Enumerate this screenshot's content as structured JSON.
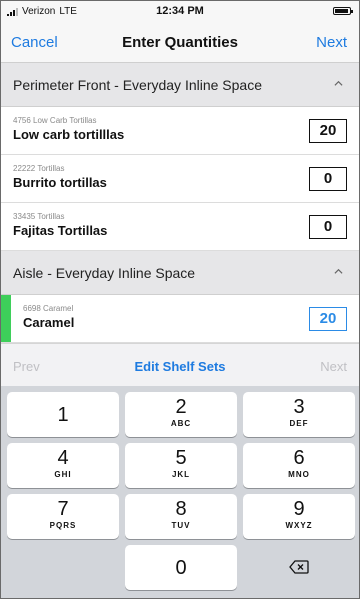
{
  "status_bar": {
    "carrier": "Verizon",
    "network": "LTE",
    "time": "12:34 PM",
    "battery_level": 0.9
  },
  "nav": {
    "cancel_label": "Cancel",
    "title": "Enter Quantities",
    "next_label": "Next"
  },
  "sections": [
    {
      "title": "Perimeter Front - Everyday Inline Space",
      "items": [
        {
          "sub": "4756 Low Carb Tortillas",
          "name": "Low carb tortilllas",
          "qty": "20"
        },
        {
          "sub": "22222 Tortillas",
          "name": "Burrito tortillas",
          "qty": "0"
        },
        {
          "sub": "33435 Tortillas",
          "name": "Fajitas Tortillas",
          "qty": "0"
        }
      ]
    },
    {
      "title": "Aisle - Everyday Inline Space",
      "items": [
        {
          "sub": "6698 Caramel",
          "name": "Caramel",
          "qty": "20"
        }
      ]
    }
  ],
  "toolbar": {
    "prev_label": "Prev",
    "edit_label": "Edit Shelf Sets",
    "next_label": "Next"
  },
  "keypad": {
    "keys": [
      {
        "digit": "1",
        "letters": ""
      },
      {
        "digit": "2",
        "letters": "ABC"
      },
      {
        "digit": "3",
        "letters": "DEF"
      },
      {
        "digit": "4",
        "letters": "GHI"
      },
      {
        "digit": "5",
        "letters": "JKL"
      },
      {
        "digit": "6",
        "letters": "MNO"
      },
      {
        "digit": "7",
        "letters": "PQRS"
      },
      {
        "digit": "8",
        "letters": "TUV"
      },
      {
        "digit": "9",
        "letters": "WXYZ"
      },
      {
        "digit": "0",
        "letters": ""
      }
    ],
    "delete_icon": "backspace-icon"
  },
  "colors": {
    "accent": "#1e7be0",
    "active_field": "#2b8be6",
    "active_indicator": "#3ecf5a",
    "section_header": "#e6e6e8",
    "keypad_bg": "#d2d5da"
  }
}
